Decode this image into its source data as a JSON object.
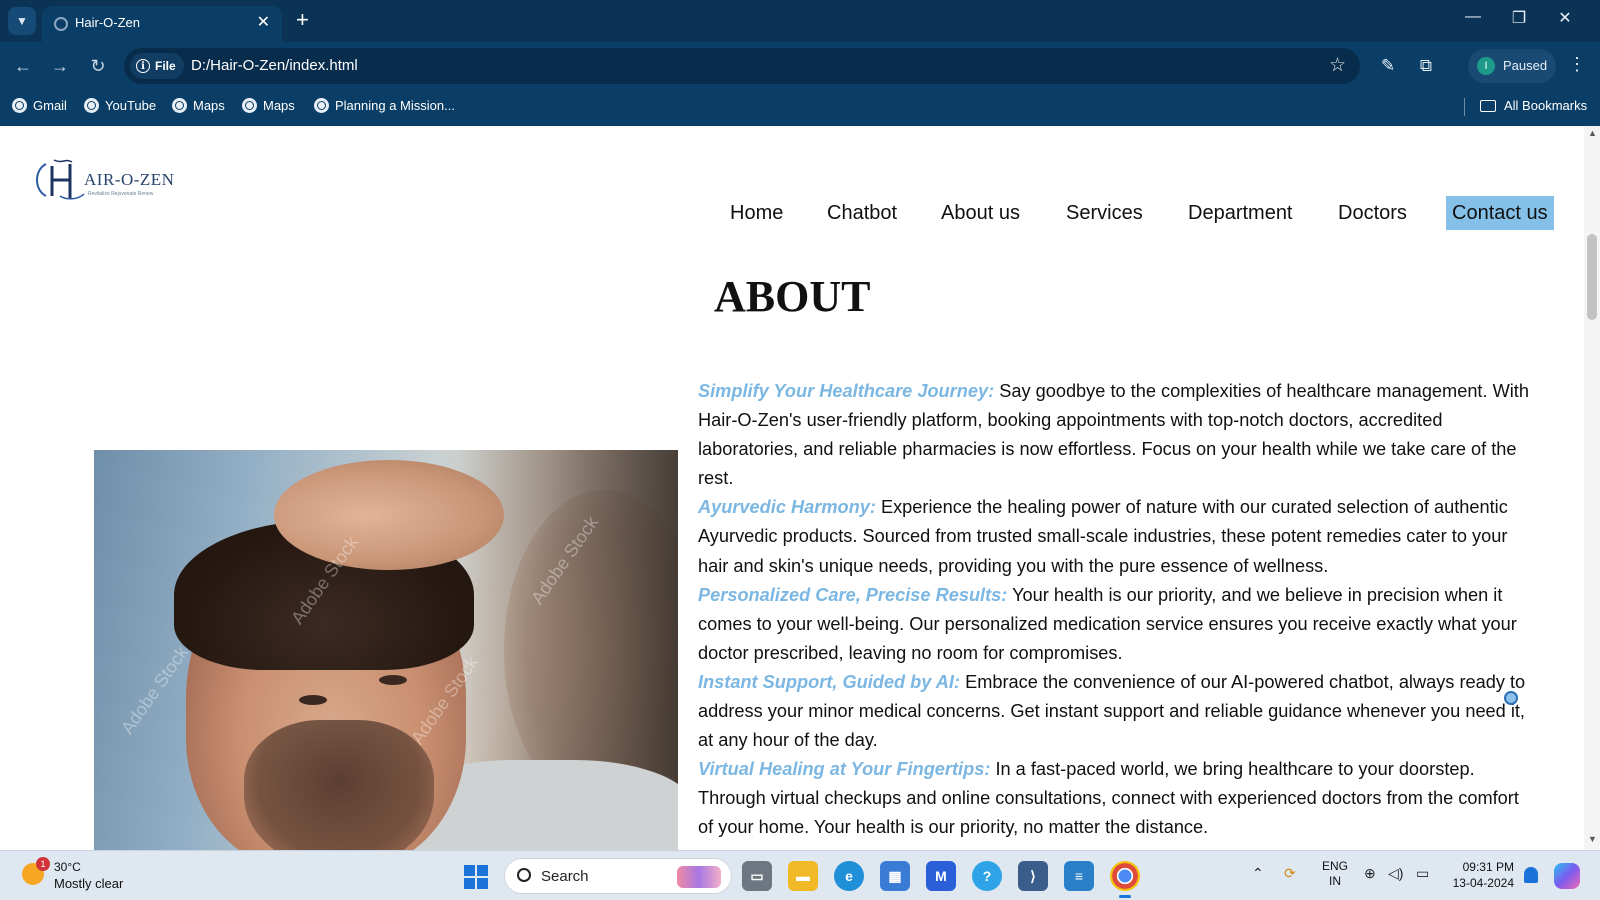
{
  "browser": {
    "tab_title": "Hair-O-Zen",
    "omnibox_chip": "File",
    "url": "D:/Hair-O-Zen/index.html",
    "profile_status": "Paused",
    "profile_initial": "I",
    "bookmarks": [
      "Gmail",
      "YouTube",
      "Maps",
      "Maps",
      "Planning a Mission..."
    ],
    "all_bookmarks": "All Bookmarks"
  },
  "site": {
    "logo_text": "AIR-O-ZEN",
    "logo_tagline": "Revitalize Rejuvenate Renew",
    "nav": [
      "Home",
      "Chatbot",
      "About us",
      "Services",
      "Department",
      "Doctors",
      "Contact us"
    ],
    "active_nav": "Contact us",
    "accent_color": "#7bb7e2",
    "nav_highlight_color": "#84c0e7"
  },
  "about": {
    "title": "ABOUT",
    "image_watermark": "Adobe Stock",
    "sections": [
      {
        "heading": "Simplify Your Healthcare Journey:",
        "body": " Say goodbye to the complexities of healthcare management. With Hair-O-Zen's user-friendly platform, booking appointments with top-notch doctors, accredited laboratories, and reliable pharmacies is now effortless. Focus on your health while we take care of the rest."
      },
      {
        "heading": "Ayurvedic Harmony:",
        "body": " Experience the healing power of nature with our curated selection of authentic Ayurvedic products. Sourced from trusted small-scale industries, these potent remedies cater to your hair and skin's unique needs, providing you with the pure essence of wellness."
      },
      {
        "heading": "Personalized Care, Precise Results:",
        "body": " Your health is our priority, and we believe in precision when it comes to your well-being. Our personalized medication service ensures you receive exactly what your doctor prescribed, leaving no room for compromises."
      },
      {
        "heading": "Instant Support, Guided by AI:",
        "body": " Embrace the convenience of our AI-powered chatbot, always ready to address your minor medical concerns. Get instant support and reliable guidance whenever you need it, at any hour of the day."
      },
      {
        "heading": "Virtual Healing at Your Fingertips:",
        "body": " In a fast-paced world, we bring healthcare to your doorstep. Through virtual checkups and online consultations, connect with experienced doctors from the comfort of your home. Your health is our priority, no matter the distance."
      }
    ]
  },
  "taskbar": {
    "weather_badge": "1",
    "temperature": "30°C",
    "condition": "Mostly clear",
    "search_placeholder": "Search",
    "lang_line1": "ENG",
    "lang_line2": "IN",
    "time": "09:31 PM",
    "date": "13-04-2024",
    "apps": [
      "task-view",
      "file-explorer",
      "edge",
      "store",
      "mcafee",
      "bluetooth-app",
      "vs-code",
      "notepad",
      "chrome"
    ]
  }
}
